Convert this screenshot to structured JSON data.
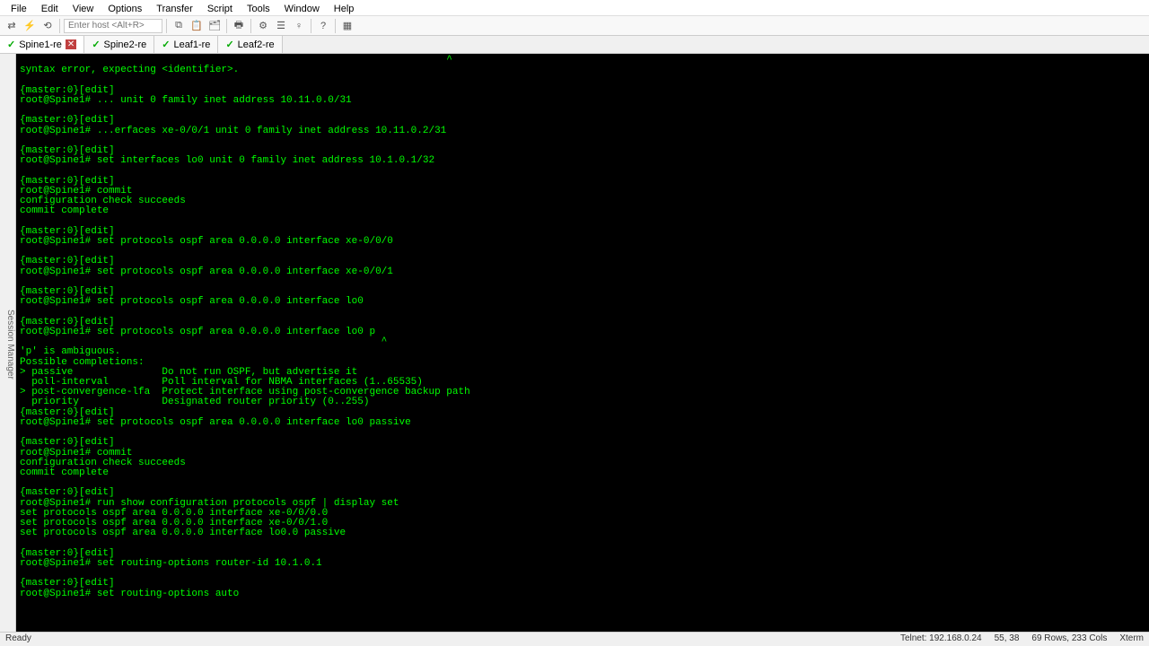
{
  "menu": [
    "File",
    "Edit",
    "View",
    "Options",
    "Transfer",
    "Script",
    "Tools",
    "Window",
    "Help"
  ],
  "host_placeholder": "Enter host <Alt+R>",
  "tabs": [
    {
      "check": "✓",
      "label": "Spine1-re",
      "active": true,
      "close": "x"
    },
    {
      "check": "✓",
      "label": "Spine2-re",
      "active": false,
      "close": ""
    },
    {
      "check": "✓",
      "label": "Leaf1-re",
      "active": false,
      "close": ""
    },
    {
      "check": "✓",
      "label": "Leaf2-re",
      "active": false,
      "close": ""
    }
  ],
  "side_label": "Session Manager",
  "terminal_lines": [
    "                                                                        ^",
    "syntax error, expecting <identifier>.",
    "",
    "{master:0}[edit]",
    "root@Spine1# ... unit 0 family inet address 10.11.0.0/31",
    "",
    "{master:0}[edit]",
    "root@Spine1# ...erfaces xe-0/0/1 unit 0 family inet address 10.11.0.2/31",
    "",
    "{master:0}[edit]",
    "root@Spine1# set interfaces lo0 unit 0 family inet address 10.1.0.1/32",
    "",
    "{master:0}[edit]",
    "root@Spine1# commit",
    "configuration check succeeds",
    "commit complete",
    "",
    "{master:0}[edit]",
    "root@Spine1# set protocols ospf area 0.0.0.0 interface xe-0/0/0",
    "",
    "{master:0}[edit]",
    "root@Spine1# set protocols ospf area 0.0.0.0 interface xe-0/0/1",
    "",
    "{master:0}[edit]",
    "root@Spine1# set protocols ospf area 0.0.0.0 interface lo0",
    "",
    "{master:0}[edit]",
    "root@Spine1# set protocols ospf area 0.0.0.0 interface lo0 p",
    "                                                             ^",
    "'p' is ambiguous.",
    "Possible completions:",
    "> passive               Do not run OSPF, but advertise it",
    "  poll-interval         Poll interval for NBMA interfaces (1..65535)",
    "> post-convergence-lfa  Protect interface using post-convergence backup path",
    "  priority              Designated router priority (0..255)",
    "{master:0}[edit]",
    "root@Spine1# set protocols ospf area 0.0.0.0 interface lo0 passive",
    "",
    "{master:0}[edit]",
    "root@Spine1# commit",
    "configuration check succeeds",
    "commit complete",
    "",
    "{master:0}[edit]",
    "root@Spine1# run show configuration protocols ospf | display set",
    "set protocols ospf area 0.0.0.0 interface xe-0/0/0.0",
    "set protocols ospf area 0.0.0.0 interface xe-0/0/1.0",
    "set protocols ospf area 0.0.0.0 interface lo0.0 passive",
    "",
    "{master:0}[edit]",
    "root@Spine1# set routing-options router-id 10.1.0.1",
    "",
    "{master:0}[edit]",
    "root@Spine1# set routing-options auto"
  ],
  "status": {
    "left": "Ready",
    "conn": "Telnet: 192.168.0.24",
    "pos": "55,  38",
    "dims": "69 Rows, 233 Cols",
    "emul": "Xterm"
  }
}
